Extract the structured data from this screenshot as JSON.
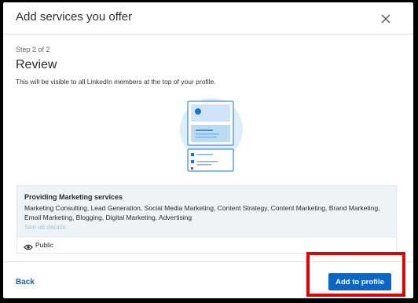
{
  "modal": {
    "title": "Add services you offer",
    "close_icon": "close-icon",
    "step": "Step 2 of 2",
    "heading": "Review",
    "note": "This will be visible to all LinkedIn members at the top of your profile.",
    "illustration_icon": "profile-cards-illustration"
  },
  "services": {
    "title": "Providing Marketing services",
    "list": "Marketing Consulting, Lead Generation, Social Media Marketing, Content Strategy, Content Marketing, Brand Marketing, Email Marketing, Blogging, Digital Marketing, Advertising",
    "see_all": "See all details"
  },
  "visibility": {
    "icon": "eye-icon",
    "label": "Public"
  },
  "footer": {
    "back_label": "Back",
    "add_label": "Add to profile"
  },
  "colors": {
    "accent": "#0a66c2",
    "highlight": "#e00000",
    "panel_bg": "#eef3f8"
  }
}
